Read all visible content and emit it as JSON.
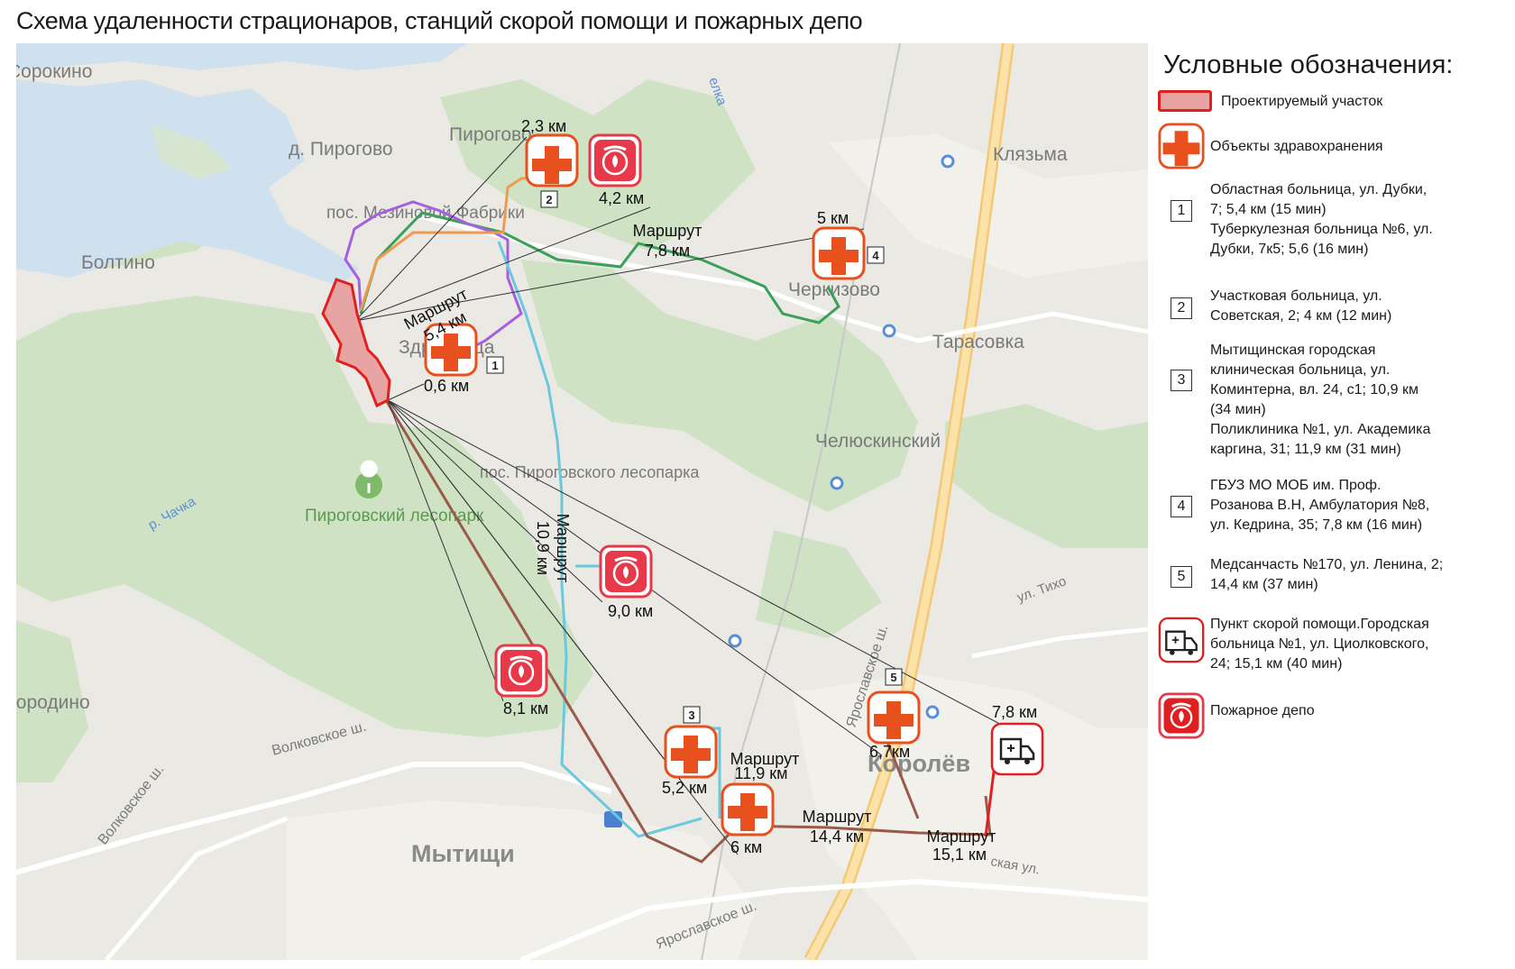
{
  "title": "Схема удаленности страционаров, станций скорой помощи и пожарных депо",
  "colors": {
    "site_fill": "#e8a3a3",
    "site_stroke": "#e02020",
    "medical_cross": "#e8501e",
    "fire_fill": "#e8394a",
    "route_green": "#3aa05a",
    "route_purple": "#a560e0",
    "route_cyan": "#6cc8dc",
    "route_brown": "#9a5a4a",
    "route_red": "#e02020",
    "route_orange": "#f09a50",
    "forest": "#c9dfbf",
    "water": "#cfe0ee"
  },
  "map": {
    "places": {
      "sorokino": "Сорокино",
      "pirogovo_village": "д. Пирогово",
      "pirogovo": "Пирогово",
      "mezinovka": "пос. Мезиновой Фабрики",
      "boltino": "Болтино",
      "zdravnitsa": "Здравница",
      "klyazma": "Клязьма",
      "cherkizovo": "Черкизово",
      "tarasovka": "Тарасовка",
      "chelyuskinsky": "Челюскинский",
      "lesopark_settlement": "пос. Пироговского лесопарка",
      "lesopark": "Пироговский лесопарк",
      "chachka": "р. Чачка",
      "borodino": "Бородино",
      "volkovskoe": "Волковское ш.",
      "volkovskoe2": "Волковское ш.",
      "yaroslavskoe": "Ярославское ш.",
      "yaroslavskoe2": "Ярославское ш.",
      "tikhomirova": "ул. Тихо",
      "korolev": "Королёв",
      "mytishchi": "Мытищи",
      "lelka": "елка",
      "bolshevistskaya": "ская ул."
    },
    "distances": {
      "d_2_3": "2,3 км",
      "d_4_2": "4,2 км",
      "d_5": "5 км",
      "d_0_6": "0,6 км",
      "d_9_0": "9,0 км",
      "d_8_1": "8,1 км",
      "d_5_2": "5,2 км",
      "d_6": "6 км",
      "d_6_7": "6,7км",
      "d_7_8b": "7,8 км"
    },
    "routes": {
      "r_7_8": [
        "Маршрут",
        "7,8 км"
      ],
      "r_5_4": [
        "Маршрут",
        "5,4 км"
      ],
      "r_10_9": [
        "Маршрут",
        "10,9 км"
      ],
      "r_11_9": [
        "Маршрут",
        "11,9 км"
      ],
      "r_14_4": [
        "Маршрут",
        "14,4 км"
      ],
      "r_15_1": [
        "Маршрут",
        "15,1 км"
      ]
    },
    "markers": {
      "n1": "1",
      "n2": "2",
      "n3": "3",
      "n4": "4",
      "n5": "5"
    }
  },
  "legend": {
    "title": "Условные обозначения:",
    "items": [
      {
        "symbol": "site-swatch",
        "text": "Проектируемый участок"
      },
      {
        "symbol": "medical-cross-icon",
        "text": "Объекты здравохранения"
      },
      {
        "symbol": "number-box",
        "number": "1",
        "lines": [
          "Областная больница, ул. Дубки,",
          "7; 5,4 км (15 мин)",
          "Туберкулезная больница №6, ул.",
          "Дубки, 7к5; 5,6 (16 мин)"
        ]
      },
      {
        "symbol": "number-box",
        "number": "2",
        "lines": [
          "Участковая больница, ул.",
          "Советская, 2; 4 км (12 мин)"
        ]
      },
      {
        "symbol": "number-box",
        "number": "3",
        "lines": [
          "Мытищинская городская",
          "клиническая больница, ул.",
          "Коминтерна, вл. 24, с1; 10,9 км",
          "(34 мин)",
          "Поликлиника №1, ул. Академика",
          "каргина, 31; 11,9 км (31 мин)"
        ]
      },
      {
        "symbol": "number-box",
        "number": "4",
        "lines": [
          "ГБУЗ МО МОБ им. Проф.",
          "Розанова В.Н, Амбулатория №8,",
          "ул. Кедрина, 35; 7,8 км (16 мин)"
        ]
      },
      {
        "symbol": "number-box",
        "number": "5",
        "lines": [
          "Медсанчасть №170, ул. Ленина, 2;",
          "14,4 км (37 мин)"
        ]
      },
      {
        "symbol": "ambulance-icon",
        "lines": [
          "Пункт скорой помощи.Городская",
          "больница №1, ул. Циолковского,",
          "24; 15,1 км (40 мин)"
        ]
      },
      {
        "symbol": "fire-station-icon",
        "lines": [
          "Пожарное депо"
        ]
      }
    ]
  }
}
